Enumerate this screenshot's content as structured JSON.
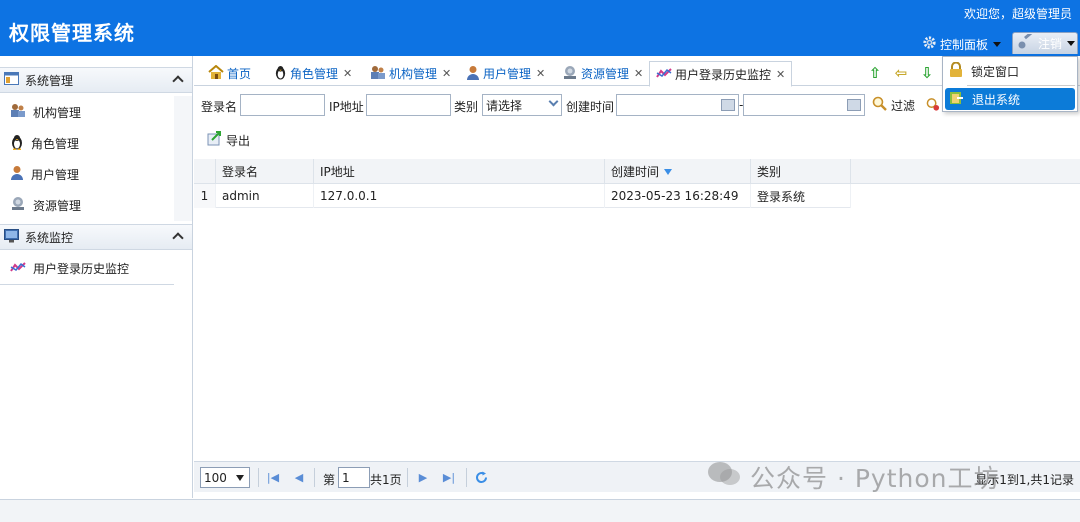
{
  "app": {
    "title": "权限管理系统",
    "welcome": "欢迎您，超级管理员"
  },
  "header": {
    "control_panel": "控制面板",
    "logout": "注销"
  },
  "dropdown": {
    "lock": "锁定窗口",
    "exit": "退出系统"
  },
  "sidebar": {
    "groups": [
      {
        "title": "系统管理",
        "items": [
          "机构管理",
          "角色管理",
          "用户管理",
          "资源管理"
        ]
      },
      {
        "title": "系统监控",
        "items": [
          "用户登录历史监控"
        ]
      }
    ]
  },
  "tabs": [
    "首页",
    "角色管理",
    "机构管理",
    "用户管理",
    "资源管理",
    "用户登录历史监控"
  ],
  "filter": {
    "login_label": "登录名",
    "ip_label": "IP地址",
    "category_label": "类别",
    "category_value": "请选择",
    "created_label": "创建时间",
    "dash": "-",
    "filter_btn": "过滤"
  },
  "toolbar": {
    "export": "导出"
  },
  "grid": {
    "headers": [
      "登录名",
      "IP地址",
      "创建时间",
      "类别"
    ],
    "rows": [
      {
        "num": "1",
        "login": "admin",
        "ip": "127.0.0.1",
        "created": "2023-05-23 16:28:49",
        "category": "登录系统"
      }
    ]
  },
  "pager": {
    "page_size": "100",
    "page_prefix": "第",
    "page": "1",
    "page_suffix": "共1页",
    "info": "显示1到1,共1记录"
  },
  "watermark": {
    "text": "公众号 · Python工坊"
  },
  "colors": {
    "header_bg": "#0d73e3",
    "active_menu": "#0c7bd8"
  }
}
